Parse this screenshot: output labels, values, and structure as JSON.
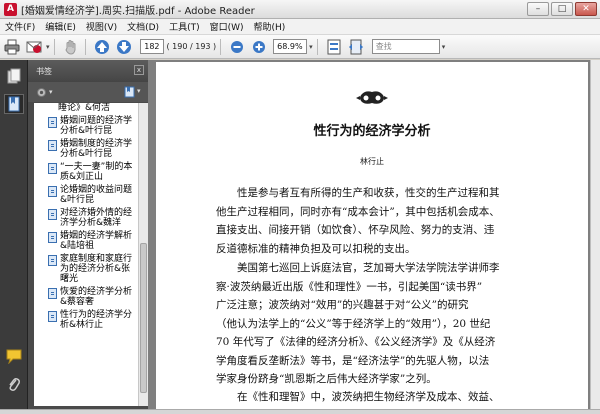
{
  "window": {
    "title": "[婚姻爱情经济学].周实.扫描版.pdf - Adobe Reader",
    "controls": {
      "minimize": "–",
      "maximize": "□",
      "close": "✕"
    }
  },
  "menu": [
    "文件(F)",
    "编辑(E)",
    "视图(V)",
    "文档(D)",
    "工具(T)",
    "窗口(W)",
    "帮助(H)"
  ],
  "toolbar": {
    "page_input": "182",
    "page_count": "( 190 / 193 )",
    "zoom": "68.9%",
    "search_placeholder": "查找",
    "icons": [
      "print-icon",
      "email-icon",
      "hand-icon",
      "page-up-icon",
      "page-down-icon",
      "zoom-out-icon",
      "zoom-in-icon",
      "fit-page-icon",
      "fit-width-icon"
    ]
  },
  "sidebar": {
    "header": "书签",
    "close_glyph": "x",
    "bookmarks": [
      "睡论》&何洁",
      "婚姻问题的经济学分析&叶行昆",
      "婚姻制度的经济学分析&叶行昆",
      "“一夫一妻”制的本质&刘正山",
      "论婚姻的收益问题&叶行昆",
      "对经济婚外情的经济学分析&魏洋",
      "婚姻的经济学解析&陆培祖",
      "家庭制度和家庭行为的经济分析&张曙光",
      "恢爱的经济学分析&蔡容奢",
      "性行为的经济学分析&林行止"
    ]
  },
  "document": {
    "title": "性行为的经济学分析",
    "author": "林行止",
    "paragraphs": [
      [
        "性是参与者互有所得的生产和收获，性交的生产过程和其",
        "他生产过程相同，同时亦有“成本会计”，其中包括机会成本、",
        "直接支出、间接开销（如饮食）、怀孕风险、努力的支消、违",
        "反道德标准的精神负担及可以扣税的支出。"
      ],
      [
        "美国第七巡回上诉庭法官，芝加哥大学法学院法学讲师李",
        "察·波茨纳最近出版《性和理性》一书，引起美国“读书界”",
        "广泛注意；波茨纳对“效用”的兴趣甚于对“公义”的研究",
        "（他认为法学上的“公义”等于经济学上的“效用”），20 世纪",
        "70 年代写了《法律的经济分析》、《公义经济学》及《从经济",
        "学角度看反垄断法》等书，是“经济法学”的先驱人物，以法",
        "学家身份跻身“凯恩斯之后伟大经济学家”之列。"
      ],
      [
        "在《性和理智》中，波茨纳把生物经济学及成本、效益、"
      ]
    ]
  }
}
